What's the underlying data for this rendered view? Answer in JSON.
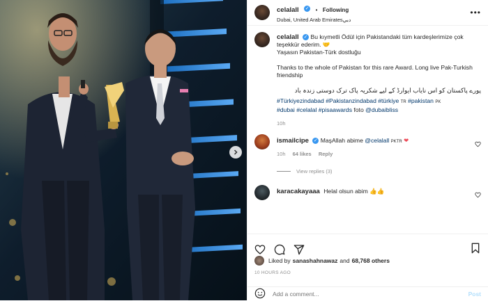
{
  "header": {
    "username": "celalall",
    "following_label": "Following",
    "location": "Dubai, United Arab Emiratesدبي"
  },
  "caption": {
    "username": "celalall",
    "line1": "Bu kıymetli Ödül için Pakistandaki tüm kardeşlerimize çok teşekkür ederim. 🤝",
    "line2": "Yaşasın Pakistan-Türk dostluğu",
    "english": "Thanks to the whole of Pakistan for this rare Award. Long live Pak-Turkish friendship",
    "urdu": "پورے پاکستان کو اس نایاب ایوارڈ کے لیے شکریہ پاک ترک دوستی زندہ باد",
    "hashtags_line1": [
      "#Türkiyezindabad",
      "#Pakistanzindabad",
      "#türkiye"
    ],
    "tr": "TR",
    "hashtag_pakistan": "#pakistan",
    "pk": "PK",
    "hashtags_line2": [
      "#dubai",
      "#celalal",
      "#pisaawards"
    ],
    "foto_label": "foto",
    "mention": "@dubaibliss",
    "time": "10h"
  },
  "comments": [
    {
      "username": "ismailcipe",
      "text": "MaşAllah abime",
      "mention": "@celalall",
      "flags": "PKTR",
      "time": "10h",
      "likes": "64 likes",
      "reply_label": "Reply",
      "view_replies": "View replies (3)"
    },
    {
      "username": "karacakayaaa",
      "text": "Helal olsun abim 👍👍"
    }
  ],
  "likes": {
    "prefix": "Liked by",
    "user": "sanashahnawaz",
    "connector": "and",
    "others": "68,768 others"
  },
  "timestamp": "10 HOURS AGO",
  "add_comment": {
    "placeholder": "Add a comment...",
    "post_label": "Post"
  },
  "icons": [
    "heart-icon",
    "comment-icon",
    "share-icon",
    "bookmark-icon",
    "more-icon",
    "next-arrow-icon",
    "smile-icon"
  ],
  "colors": {
    "link": "#00376b",
    "verified": "#3897f0",
    "post_button": "#b2dffc",
    "photo_bg": "#0b1420"
  }
}
